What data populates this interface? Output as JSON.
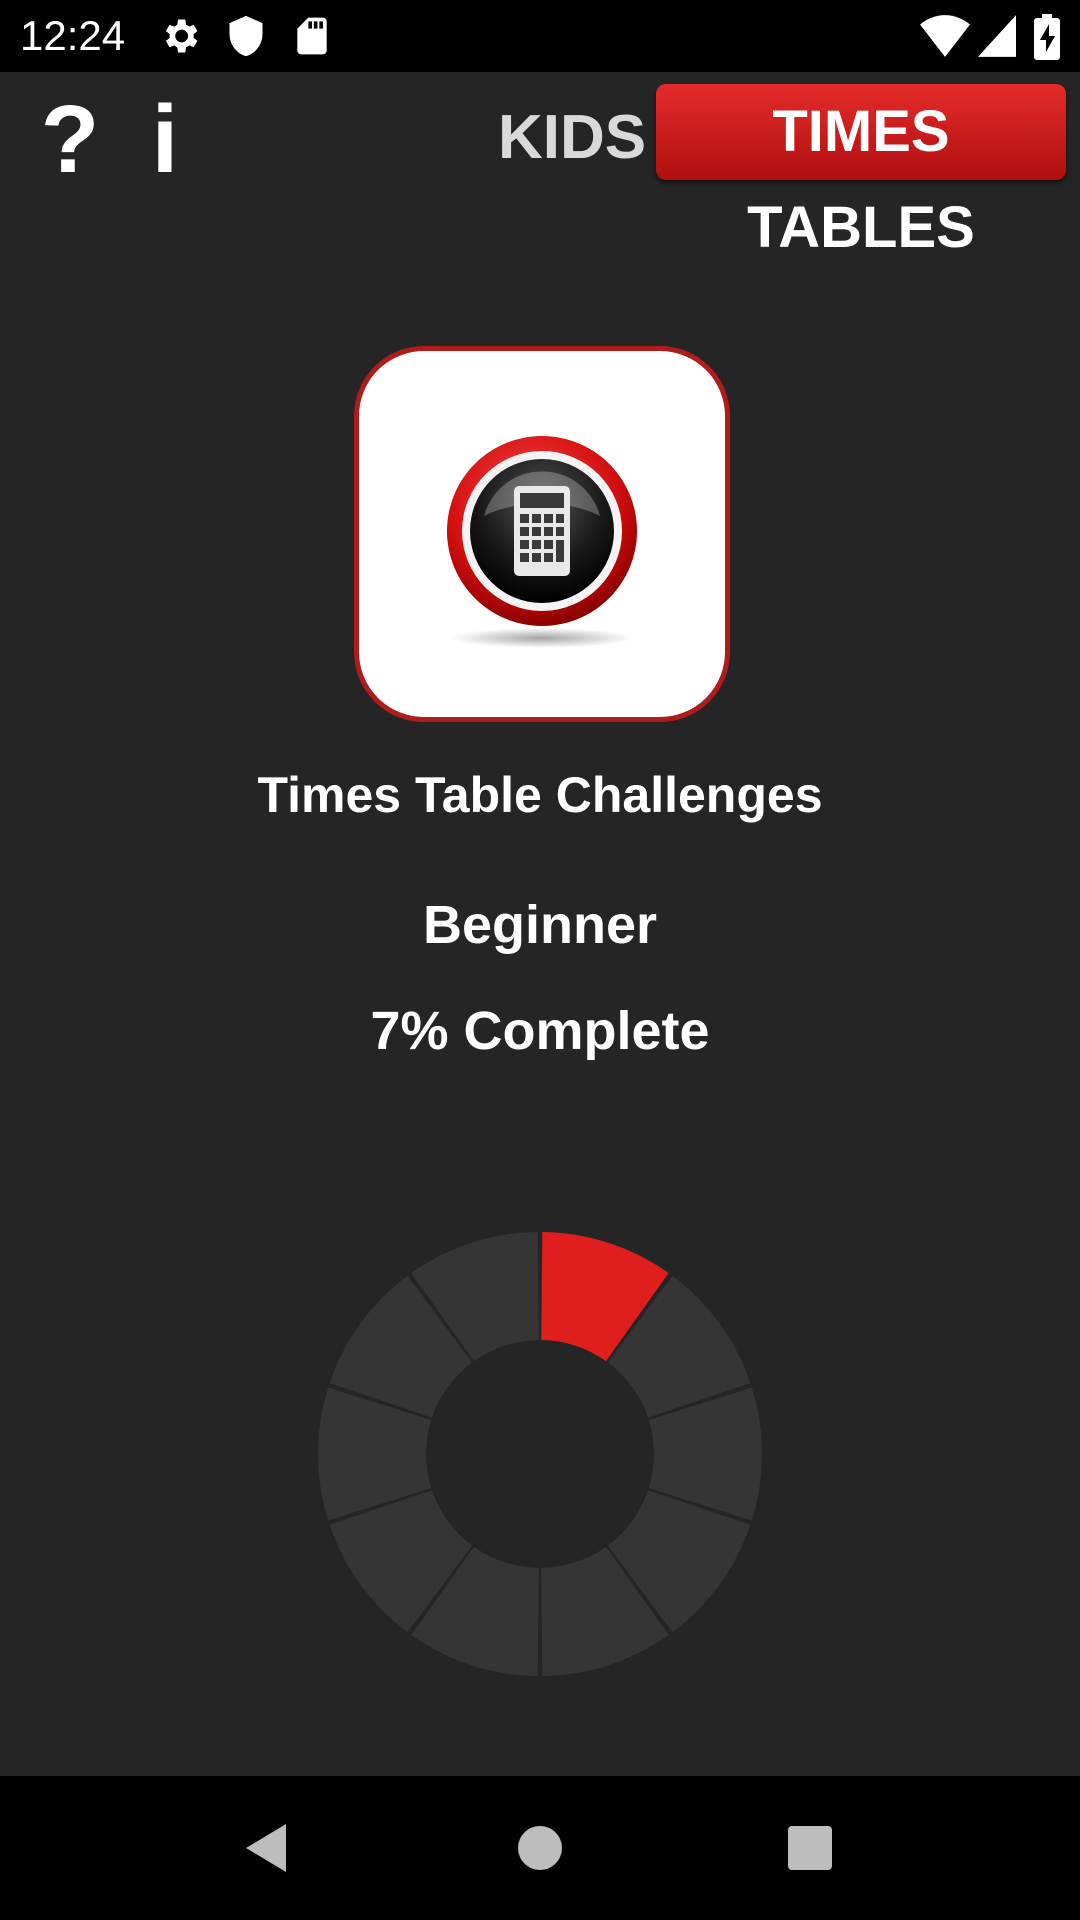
{
  "status_bar": {
    "time": "12:24",
    "icons": [
      "gear-icon",
      "shield-icon",
      "sd-card-icon",
      "wifi-icon",
      "signal-icon",
      "battery-charging-icon"
    ]
  },
  "header": {
    "help_label": "?",
    "info_label": "i",
    "brand_kids": "KIDS",
    "brand_times_tables": "TIMES TABLES"
  },
  "main": {
    "app_icon": "calculator-icon",
    "title": "Times Table Challenges",
    "level": "Beginner",
    "progress_text": "7% Complete",
    "progress_segments_total": 10,
    "progress_segments_filled": 1
  },
  "colors": {
    "background": "#252525",
    "accent_red": "#e01e1e",
    "segment_empty": "#353535"
  },
  "nav_bar": {
    "buttons": [
      "back-icon",
      "home-icon",
      "recents-icon"
    ]
  }
}
